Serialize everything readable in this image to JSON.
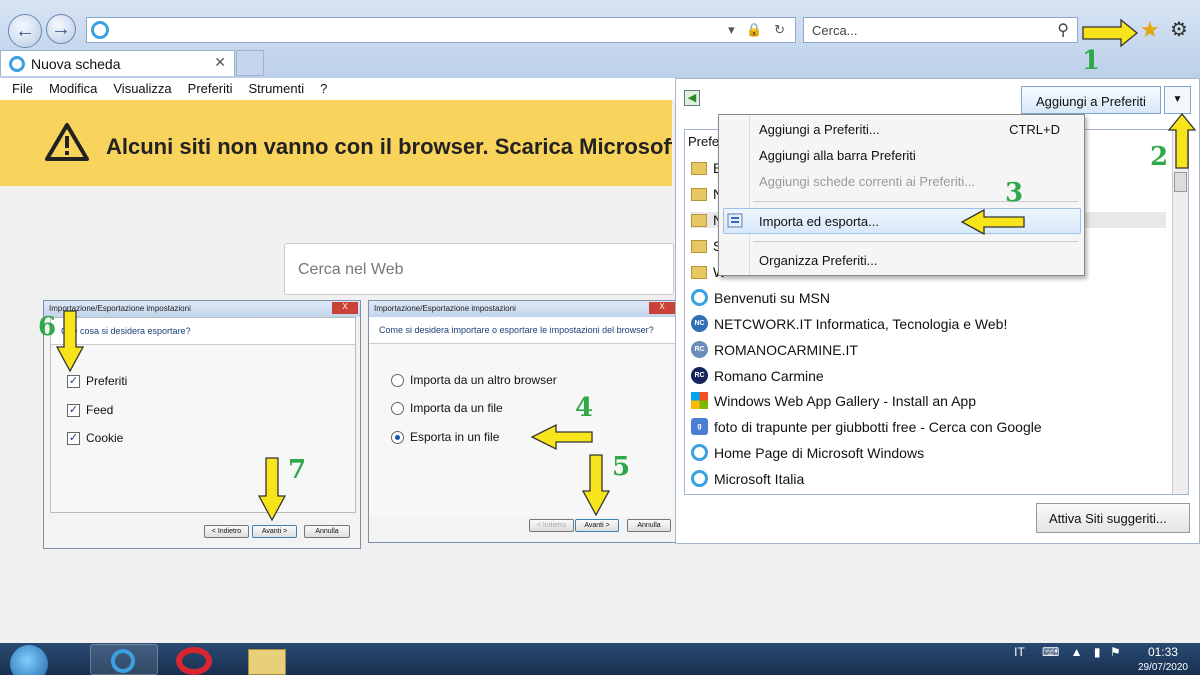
{
  "browser": {
    "address_value": "",
    "search_placeholder": "Cerca...",
    "tab_title": "Nuova scheda",
    "menu": [
      "File",
      "Modifica",
      "Visualizza",
      "Preferiti",
      "Strumenti",
      "?"
    ]
  },
  "banner": {
    "text": "Alcuni siti non vanno con il browser. Scarica Microsoft Edge"
  },
  "web_search": {
    "placeholder": "Cerca nel Web"
  },
  "export_dialog": {
    "title": "Importazione/Esportazione impostazioni",
    "question": "Che cosa si desidera esportare?",
    "options": [
      {
        "label": "Preferiti",
        "checked": true
      },
      {
        "label": "Feed",
        "checked": true
      },
      {
        "label": "Cookie",
        "checked": true
      }
    ],
    "buttons": {
      "back": "< Indietro",
      "next": "Avanti >",
      "cancel": "Annulla"
    }
  },
  "import_dialog": {
    "title": "Importazione/Esportazione impostazioni",
    "question": "Come si desidera importare o esportare le impostazioni del browser?",
    "options": [
      {
        "label": "Importa da un altro browser",
        "selected": false
      },
      {
        "label": "Importa da un file",
        "selected": false
      },
      {
        "label": "Esporta in un file",
        "selected": true
      }
    ],
    "buttons": {
      "back": "< Indietro",
      "next": "Avanti >",
      "cancel": "Annulla"
    }
  },
  "favorites": {
    "add_button": "Aggiungi a Preferiti",
    "tab_label": "Preferiti",
    "folders": [
      "B",
      "N",
      "N",
      "S",
      "W"
    ],
    "items": [
      {
        "label": "Benvenuti su MSN",
        "icon": "ie-icon"
      },
      {
        "label": "NETCWORK.IT  Informatica, Tecnologia e Web!",
        "icon": "nc-icon"
      },
      {
        "label": "ROMANOCARMINE.IT",
        "icon": "rc-icon"
      },
      {
        "label": "Romano Carmine",
        "icon": "rc-dark-icon"
      },
      {
        "label": "Windows Web App Gallery - Install an App",
        "icon": "windows-icon"
      },
      {
        "label": "foto di trapunte per giubbotti free - Cerca con Google",
        "icon": "google-icon"
      },
      {
        "label": "Home Page di Microsoft Windows",
        "icon": "ie-icon"
      },
      {
        "label": "Microsoft Italia",
        "icon": "ie-icon"
      }
    ],
    "suggest_button": "Attiva Siti suggeriti..."
  },
  "dropdown": {
    "items": [
      {
        "label": "Aggiungi a Preferiti...",
        "shortcut": "CTRL+D"
      },
      {
        "label": "Aggiungi alla barra Preferiti"
      },
      {
        "label": "Aggiungi schede correnti ai Preferiti...",
        "disabled": true
      },
      {
        "label": "Importa ed esporta...",
        "highlighted": true
      },
      {
        "label": "Organizza Preferiti..."
      }
    ]
  },
  "step_numbers": [
    "1",
    "2",
    "3",
    "4",
    "5",
    "6",
    "7"
  ],
  "taskbar": {
    "language": "IT",
    "time": "01:33",
    "date": "29/07/2020"
  },
  "colors": {
    "banner": "#f9d45c",
    "arrow": "#f7e41a",
    "step_number": "#2fa84a",
    "accent": "#3aa0e0"
  }
}
